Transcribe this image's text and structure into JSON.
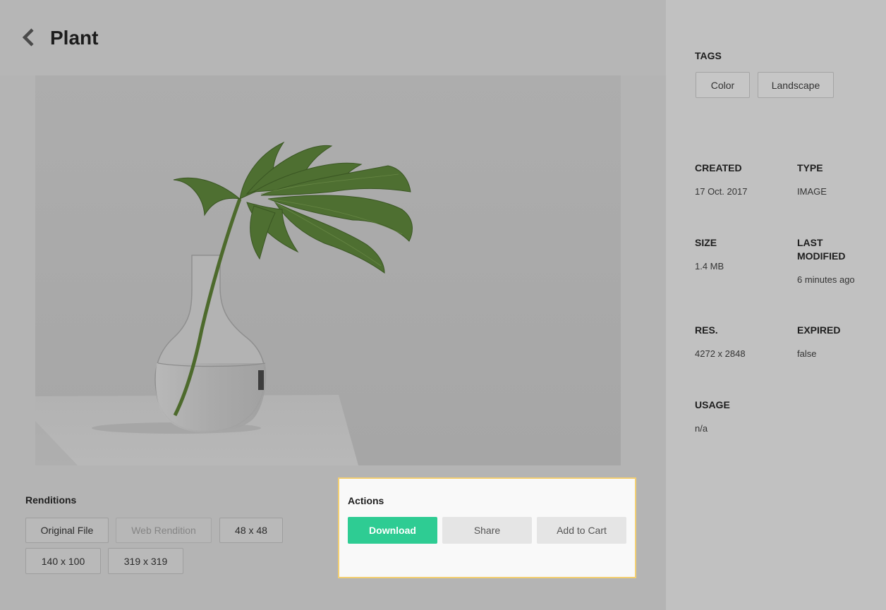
{
  "header": {
    "title": "Plant",
    "back_icon": "chevron-left-icon"
  },
  "preview": {
    "subject": "plant-photo"
  },
  "renditions": {
    "label": "Renditions",
    "items": [
      {
        "label": "Original File",
        "disabled": false
      },
      {
        "label": "Web Rendition",
        "disabled": true
      },
      {
        "label": "48 x 48",
        "disabled": false
      },
      {
        "label": "140 x 100",
        "disabled": false
      },
      {
        "label": "319 x 319",
        "disabled": false
      }
    ]
  },
  "actions": {
    "label": "Actions",
    "download": "Download",
    "share": "Share",
    "add_to_cart": "Add to Cart",
    "primary_color": "#2ecc93",
    "highlight_color": "#f3cf72"
  },
  "sidebar": {
    "tags_label": "TAGS",
    "tags": [
      "Color",
      "Landscape"
    ],
    "created_label": "CREATED",
    "created_value": "17 Oct. 2017",
    "type_label": "TYPE",
    "type_value": "IMAGE",
    "size_label": "SIZE",
    "size_value": "1.4 MB",
    "last_modified_label_1": "LAST",
    "last_modified_label_2": "MODIFIED",
    "last_modified_value": "6 minutes ago",
    "res_label": "RES.",
    "res_value": "4272 x 2848",
    "expired_label": "EXPIRED",
    "expired_value": "false",
    "usage_label": "USAGE",
    "usage_value": "n/a"
  }
}
